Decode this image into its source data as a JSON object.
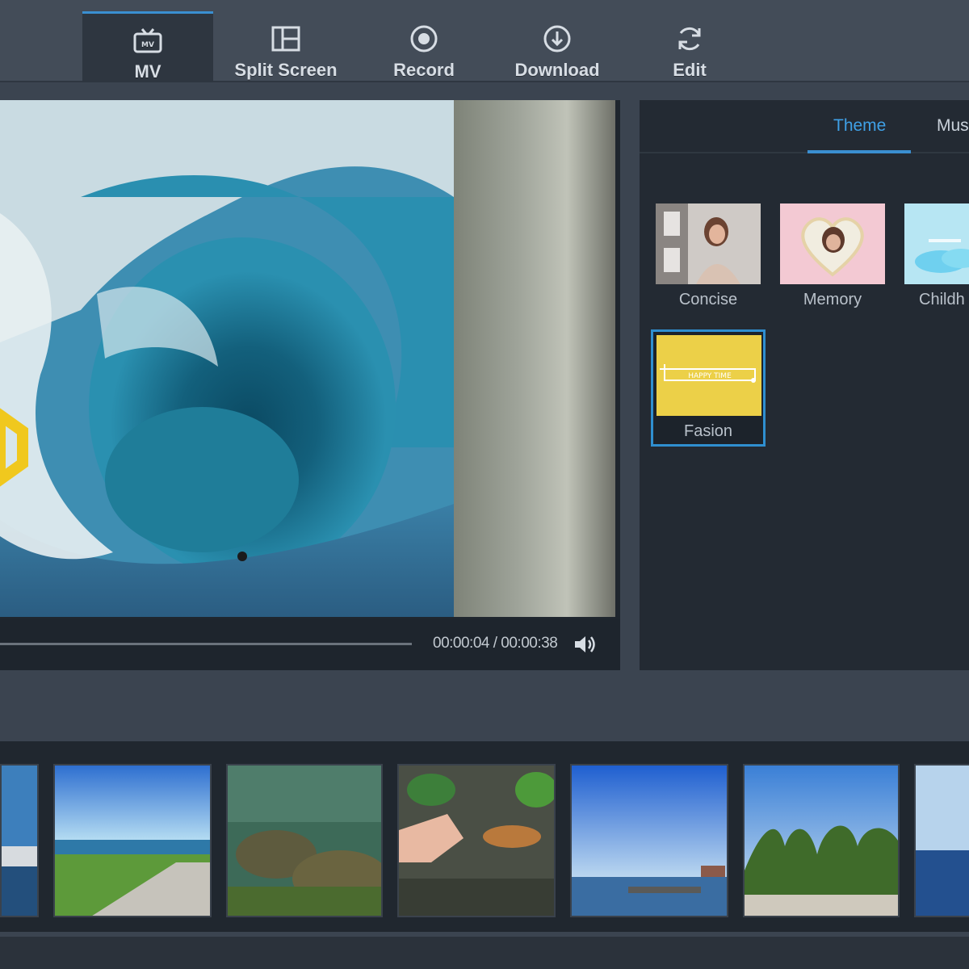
{
  "toolbar": {
    "tabs": [
      {
        "label": "MV",
        "icon": "tv-icon"
      },
      {
        "label": "Split Screen",
        "icon": "split-screen-icon"
      },
      {
        "label": "Record",
        "icon": "record-icon"
      },
      {
        "label": "Download",
        "icon": "download-icon"
      },
      {
        "label": "Edit",
        "icon": "refresh-icon"
      }
    ],
    "active": "MV"
  },
  "player": {
    "timecode": "00:00:04 / 00:00:38",
    "progress": 0.11,
    "volume_icon": "volume-icon"
  },
  "panel": {
    "tabs": [
      "Theme",
      "Mus"
    ],
    "active_tab": "Theme",
    "themes": [
      {
        "label": "Concise"
      },
      {
        "label": "Memory"
      },
      {
        "label": "Childh"
      },
      {
        "label": "Fasion",
        "selected": true,
        "banner_text": "HAPPY TIME"
      }
    ]
  },
  "colors": {
    "accent": "#3a8fd1",
    "background": "#3b4450",
    "panel": "#232a33",
    "theme_yellow": "#ecd048"
  }
}
